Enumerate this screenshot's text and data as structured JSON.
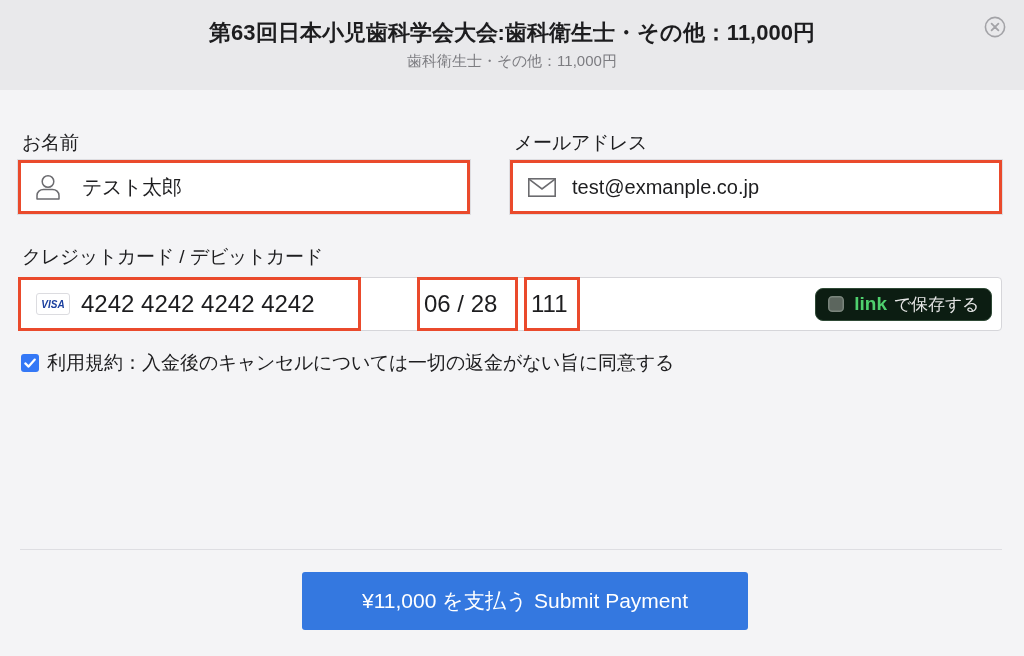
{
  "dialog": {
    "title": "第63回日本小児歯科学会大会:歯科衛生士・その他：11,000円",
    "subtitle": "歯科衛生士・その他：11,000円"
  },
  "fields": [
    {
      "kind": "name",
      "label": "お名前",
      "value": "テスト太郎",
      "highlighted": true
    },
    {
      "kind": "email",
      "label": "メールアドレス",
      "value": "test@exmanple.co.jp",
      "highlighted": true
    }
  ],
  "card": {
    "label": "クレジットカード / デビットカード",
    "brand_logo": "VISA",
    "number": {
      "value": "4242 4242 4242 4242",
      "highlighted": true
    },
    "expiry": {
      "value": "06 / 28",
      "highlighted": true
    },
    "cvc": {
      "value": "111",
      "highlighted": true
    },
    "link_save": {
      "brand": "link",
      "text": "で保存する",
      "checked": false
    }
  },
  "terms": {
    "checked": true,
    "text": "利用規約：入金後のキャンセルについては一切の返金がない旨に同意する"
  },
  "submit_button": {
    "label": "¥11,000 を支払う Submit Payment"
  }
}
